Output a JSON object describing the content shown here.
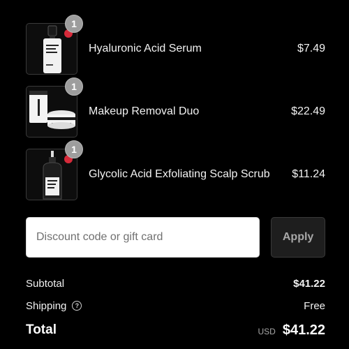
{
  "items": [
    {
      "name": "Hyaluronic Acid Serum",
      "price": "$7.49",
      "quantity": "1",
      "image": "serum-bottle"
    },
    {
      "name": "Makeup Removal Duo",
      "price": "$22.49",
      "quantity": "1",
      "image": "cleanser-tube-and-balm-jar"
    },
    {
      "name": "Glycolic Acid Exfoliating Scalp Scrub",
      "price": "$11.24",
      "quantity": "1",
      "image": "scalp-scrub-bottle"
    }
  ],
  "discount": {
    "placeholder": "Discount code or gift card",
    "value": "",
    "apply_label": "Apply"
  },
  "summary": {
    "subtotal_label": "Subtotal",
    "subtotal_value": "$41.22",
    "shipping_label": "Shipping",
    "shipping_help_icon": "?",
    "shipping_value": "Free",
    "total_label": "Total",
    "currency": "USD",
    "total_value": "$41.22"
  },
  "colors": {
    "background": "#000000",
    "text": "#f2f2f2",
    "quantity_badge": "#9d9d9d",
    "apply_button_bg": "#1e1e1e"
  }
}
